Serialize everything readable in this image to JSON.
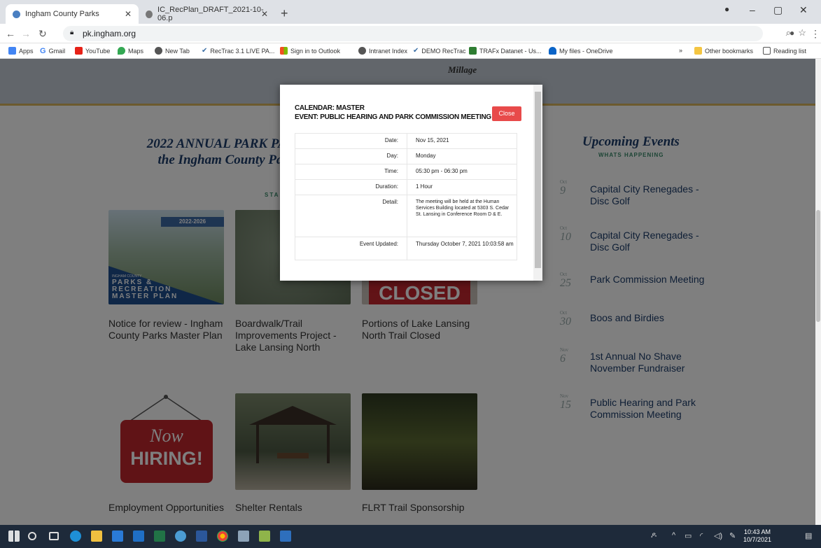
{
  "browser": {
    "tabs": [
      {
        "title": "Ingham County Parks"
      },
      {
        "title": "IC_RecPlan_DRAFT_2021-10-06.p"
      }
    ],
    "url": "pk.ingham.org",
    "bookmarks": [
      "Apps",
      "Gmail",
      "YouTube",
      "Maps",
      "New Tab",
      "RecTrac 3.1 LIVE PA...",
      "Sign in to Outlook",
      "Intranet Index",
      "DEMO RecTrac",
      "TRAFx Datanet - Us...",
      "My files - OneDrive",
      "»",
      "Other bookmarks",
      "Reading list"
    ]
  },
  "page": {
    "millage_label": "Millage",
    "pass_title": "2022 ANNUAL PARK PAS",
    "pass_title_2": "the Ingham County Pa",
    "pass_title_3": "pu",
    "stay_label": "STA",
    "cards": [
      {
        "caption": "Notice for review - Ingham County Parks Master Plan",
        "image_text": "PARKS & RECREATION MASTER PLAN",
        "image_badge": "2022-2026",
        "image_county": "INGHAM COUNTY"
      },
      {
        "caption": "Boardwalk/Trail Improvements Project - Lake Lansing North"
      },
      {
        "caption": "Portions of Lake Lansing North Trail Closed",
        "image_text": "CLOSED"
      },
      {
        "caption": "Employment Opportunities",
        "image_text_1": "Now",
        "image_text_2": "HIRING!"
      },
      {
        "caption": "Shelter Rentals"
      },
      {
        "caption": "FLRT Trail Sponsorship"
      }
    ],
    "events": {
      "title": "Upcoming Events",
      "subtitle": "WHATS HAPPENING",
      "items": [
        {
          "month": "Oct",
          "day": "9",
          "name": "Capital City Renegades - Disc Golf"
        },
        {
          "month": "Oct",
          "day": "10",
          "name": "Capital City Renegades - Disc Golf"
        },
        {
          "month": "Oct",
          "day": "25",
          "name": "Park Commission Meeting"
        },
        {
          "month": "Oct",
          "day": "30",
          "name": "Boos and Birdies"
        },
        {
          "month": "Nov",
          "day": "6",
          "name": "1st Annual No Shave November Fundraiser"
        },
        {
          "month": "Nov",
          "day": "15",
          "name": "Public Hearing and Park Commission Meeting"
        }
      ]
    }
  },
  "modal": {
    "calendar": "CALENDAR: MASTER",
    "event": "EVENT: PUBLIC HEARING AND PARK COMMISSION MEETING",
    "close_label": "Close",
    "rows": [
      {
        "label": "Date:",
        "value": "Nov 15, 2021"
      },
      {
        "label": "Day:",
        "value": "Monday"
      },
      {
        "label": "Time:",
        "value": "05:30 pm - 06:30 pm"
      },
      {
        "label": "Duration:",
        "value": "1 Hour"
      },
      {
        "label": "Detail:",
        "value": "The meeting will be held at the Human Services Building located at 5303 S. Cedar St. Lansing in Conference Room D & E."
      },
      {
        "label": "Event Updated:",
        "value": "Thursday October 7, 2021 10:03:58 am"
      }
    ]
  },
  "taskbar": {
    "time": "10:43 AM",
    "date": "10/7/2021"
  }
}
